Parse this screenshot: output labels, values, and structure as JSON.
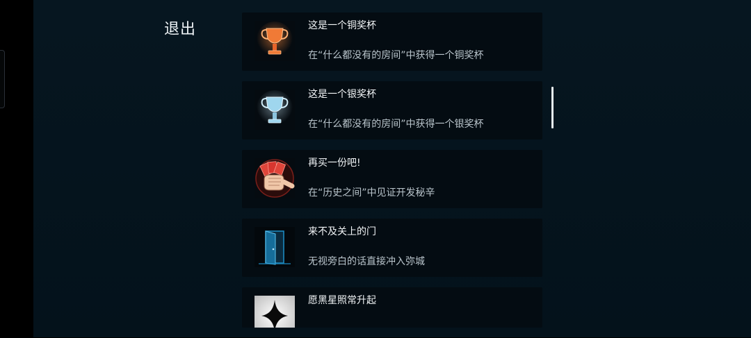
{
  "exit_label": "退出",
  "achievements": [
    {
      "icon": "bronze-trophy-icon",
      "title": "这是一个铜奖杯",
      "description": "在“什么都没有的房间”中获得一个铜奖杯"
    },
    {
      "icon": "silver-trophy-icon",
      "title": "这是一个银奖杯",
      "description": "在“什么都没有的房间”中获得一个银奖杯"
    },
    {
      "icon": "fist-cards-icon",
      "title": "再买一份吧!",
      "description": "在“历史之间”中见证开发秘辛"
    },
    {
      "icon": "open-door-icon",
      "title": "来不及关上的门",
      "description": "无视旁白的话直接冲入弥城"
    },
    {
      "icon": "black-star-icon",
      "title": "愿黑星照常升起",
      "description": ""
    }
  ],
  "colors": {
    "bronze": "#e8642a",
    "silver": "#9fd6ee",
    "red": "#d8362f",
    "door_blue": "#1d8fc9"
  }
}
